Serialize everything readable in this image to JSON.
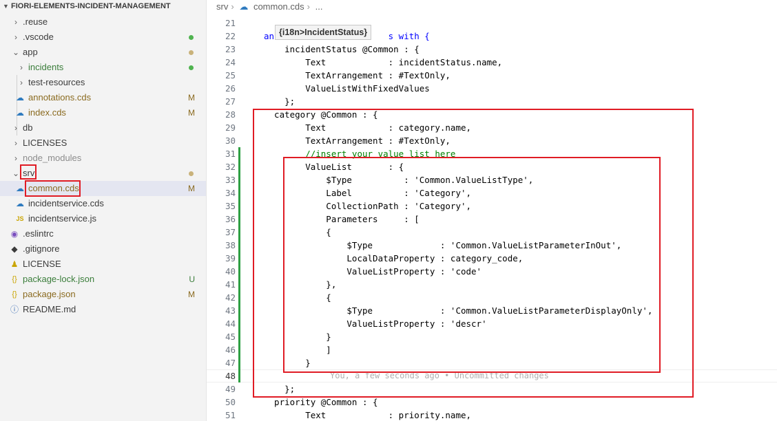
{
  "explorer": {
    "root_label": "FIORI-ELEMENTS-INCIDENT-MANAGEMENT",
    "items": [
      {
        "label": ".reuse",
        "badge": "",
        "icon": "chevron-right-icon",
        "dot": ""
      },
      {
        "label": ".vscode",
        "badge": "",
        "icon": "chevron-right-icon",
        "dot": "#4fb34f"
      },
      {
        "label": "app",
        "badge": "",
        "icon": "chevron-down-icon",
        "dot": "#c9b27a"
      },
      {
        "label": "incidents",
        "badge": "",
        "icon": "chevron-right-icon",
        "dot": "#4fb34f"
      },
      {
        "label": "test-resources",
        "badge": "",
        "icon": "chevron-right-icon",
        "dot": ""
      },
      {
        "label": "annotations.cds",
        "badge": "M",
        "icon": "cds-file-icon",
        "dot": ""
      },
      {
        "label": "index.cds",
        "badge": "M",
        "icon": "cds-file-icon",
        "dot": ""
      },
      {
        "label": "db",
        "badge": "",
        "icon": "chevron-right-icon",
        "dot": ""
      },
      {
        "label": "LICENSES",
        "badge": "",
        "icon": "chevron-right-icon",
        "dot": ""
      },
      {
        "label": "node_modules",
        "badge": "",
        "icon": "chevron-right-icon",
        "dot": ""
      },
      {
        "label": "srv",
        "badge": "",
        "icon": "chevron-down-icon",
        "dot": "#c9b27a"
      },
      {
        "label": "common.cds",
        "badge": "M",
        "icon": "cds-file-icon",
        "dot": ""
      },
      {
        "label": "incidentservice.cds",
        "badge": "",
        "icon": "cds-file-icon",
        "dot": ""
      },
      {
        "label": "incidentservice.js",
        "badge": "",
        "icon": "js-file-icon",
        "dot": ""
      },
      {
        "label": ".eslintrc",
        "badge": "",
        "icon": "eslint-icon",
        "dot": ""
      },
      {
        "label": ".gitignore",
        "badge": "",
        "icon": "git-icon",
        "dot": ""
      },
      {
        "label": "LICENSE",
        "badge": "",
        "icon": "license-icon",
        "dot": ""
      },
      {
        "label": "package-lock.json",
        "badge": "U",
        "icon": "json-icon",
        "dot": ""
      },
      {
        "label": "package.json",
        "badge": "M",
        "icon": "json-icon",
        "dot": ""
      },
      {
        "label": "README.md",
        "badge": "",
        "icon": "info-icon",
        "dot": ""
      }
    ]
  },
  "breadcrumb": {
    "folder": "srv",
    "file": "common.cds",
    "more": "..."
  },
  "tooltip": "{i18n>IncidentStatus}",
  "blame": "You, a few seconds ago • Uncommitted changes",
  "colors": {
    "accent": "#e01b24",
    "modified": "#c9b27a",
    "added": "#4fb34f",
    "git_gutter": "#2ea043"
  },
  "code": {
    "lines": [
      {
        "n": "21",
        "t": ""
      },
      {
        "n": "22",
        "t": "anno                    s with {"
      },
      {
        "n": "23",
        "t": "    incidentStatus @Common : {"
      },
      {
        "n": "24",
        "t": "        Text            : incidentStatus.name,"
      },
      {
        "n": "25",
        "t": "        TextArrangement : #TextOnly,"
      },
      {
        "n": "26",
        "t": "        ValueListWithFixedValues"
      },
      {
        "n": "27",
        "t": "    };"
      },
      {
        "n": "28",
        "t": "  category @Common : {"
      },
      {
        "n": "29",
        "t": "        Text            : category.name,"
      },
      {
        "n": "30",
        "t": "        TextArrangement : #TextOnly,"
      },
      {
        "n": "31",
        "t": "        //insert your value list here"
      },
      {
        "n": "32",
        "t": "        ValueList       : {"
      },
      {
        "n": "33",
        "t": "            $Type          : 'Common.ValueListType',"
      },
      {
        "n": "34",
        "t": "            Label          : 'Category',"
      },
      {
        "n": "35",
        "t": "            CollectionPath : 'Category',"
      },
      {
        "n": "36",
        "t": "            Parameters     : ["
      },
      {
        "n": "37",
        "t": "            {"
      },
      {
        "n": "38",
        "t": "                $Type             : 'Common.ValueListParameterInOut',"
      },
      {
        "n": "39",
        "t": "                LocalDataProperty : category_code,"
      },
      {
        "n": "40",
        "t": "                ValueListProperty : 'code'"
      },
      {
        "n": "41",
        "t": "            },"
      },
      {
        "n": "42",
        "t": "            {"
      },
      {
        "n": "43",
        "t": "                $Type             : 'Common.ValueListParameterDisplayOnly',"
      },
      {
        "n": "44",
        "t": "                ValueListProperty : 'descr'"
      },
      {
        "n": "45",
        "t": "            }"
      },
      {
        "n": "46",
        "t": "            ]"
      },
      {
        "n": "47",
        "t": "        }"
      },
      {
        "n": "48",
        "t": ""
      },
      {
        "n": "49",
        "t": "    };"
      },
      {
        "n": "50",
        "t": "  priority @Common : {"
      },
      {
        "n": "51",
        "t": "        Text            : priority.name,"
      }
    ]
  }
}
